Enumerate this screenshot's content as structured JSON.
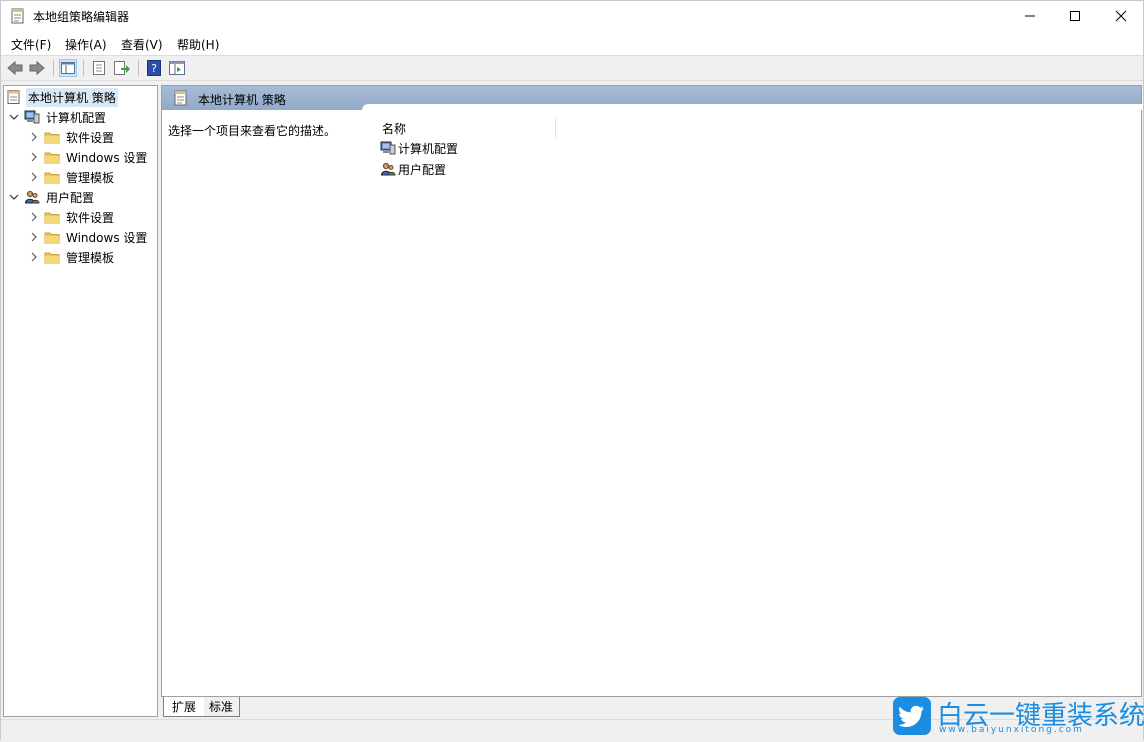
{
  "window": {
    "title": "本地组策略编辑器"
  },
  "menu": {
    "items": [
      {
        "label": "文件(F)"
      },
      {
        "label": "操作(A)"
      },
      {
        "label": "查看(V)"
      },
      {
        "label": "帮助(H)"
      }
    ]
  },
  "toolbar": {
    "buttons": [
      "back-arrow-icon",
      "forward-arrow-icon",
      "show-hide-tree-icon",
      "properties-icon",
      "export-list-icon",
      "help-icon",
      "show-action-pane-icon"
    ]
  },
  "tree": {
    "root": {
      "label": "本地计算机 策略"
    },
    "computer": {
      "label": "计算机配置",
      "children": [
        {
          "label": "软件设置"
        },
        {
          "label": "Windows 设置"
        },
        {
          "label": "管理模板"
        }
      ]
    },
    "user": {
      "label": "用户配置",
      "children": [
        {
          "label": "软件设置"
        },
        {
          "label": "Windows 设置"
        },
        {
          "label": "管理模板"
        }
      ]
    }
  },
  "rightpane": {
    "header_title": "本地计算机 策略",
    "description": "选择一个项目来查看它的描述。",
    "column_name": "名称",
    "items": [
      {
        "label": "计算机配置"
      },
      {
        "label": "用户配置"
      }
    ]
  },
  "tabs": {
    "extended": "扩展",
    "standard": "标准"
  },
  "watermark": {
    "brand": "白云一键重装系统",
    "url": "www.baiyunxitong.com"
  },
  "colors": {
    "header_blue": "#a6bcd6",
    "selection": "#d9e8f5",
    "folder": "#e8c65a",
    "watermark_blue": "#1a8de0"
  }
}
